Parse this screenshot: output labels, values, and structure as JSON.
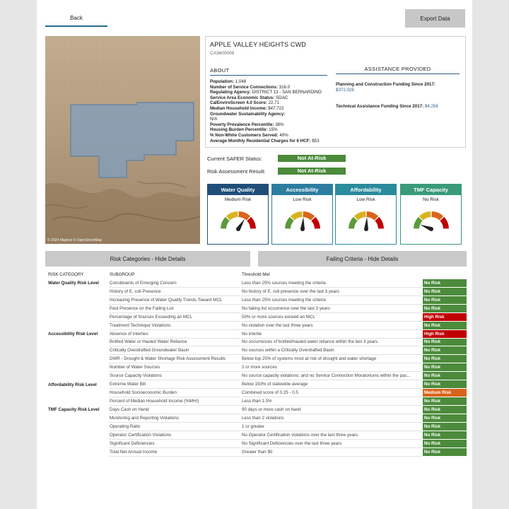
{
  "nav": {
    "back_label": "Back",
    "export_label": "Export Data"
  },
  "map": {
    "attribution": "© 2024 Mapbox © OpenStreetMap"
  },
  "system": {
    "name": "APPLE VALLEY HEIGHTS CWD",
    "id": "CA3600009"
  },
  "about": {
    "heading": "ABOUT",
    "rows": [
      {
        "label": "Population:",
        "value": "1,048"
      },
      {
        "label": "Number of Service Connections:",
        "value": "316.0"
      },
      {
        "label": "Regulating Agency:",
        "value": "DISTRICT 13 - SAN BERNARDINO"
      },
      {
        "label": "Service Area Economic Status:",
        "value": "SDAC"
      },
      {
        "label": "CalEnviroScreen 4.0 Score:",
        "value": "22.71"
      },
      {
        "label": "Median Household Income:",
        "value": "$47,722"
      },
      {
        "label": "Groundwater Sustainability Agency:",
        "value": ""
      },
      {
        "label": "",
        "value": "N/A"
      },
      {
        "label": "Poverty Prevalence Percentile:",
        "value": "38%"
      },
      {
        "label": "Housing Burden Percentile:",
        "value": "15%"
      },
      {
        "label": "% Non-White Customers Served:",
        "value": "40%"
      },
      {
        "label": "Average Monthly Residential Charges for 6 HCF:",
        "value": "$53"
      }
    ]
  },
  "assistance": {
    "heading": "ASSISTANCE PROVIDED",
    "planning_label": "Planning and Construction Funding Since 2017:",
    "planning_value": "$372,028",
    "technical_label": "Technical Assistance Funding Since 2017:",
    "technical_value": "$4,258"
  },
  "status": {
    "safer_label": "Current SAFER Status:",
    "safer_value": "Not At-Risk",
    "assessment_label": "Risk Assessment Result:",
    "assessment_value": "Not At-Risk"
  },
  "cards": [
    {
      "title": "Water Quality",
      "level": "Medium Risk",
      "color": "#1f4e79",
      "needle": 0.68
    },
    {
      "title": "Accessibility",
      "level": "Low Risk",
      "color": "#2c7da0",
      "needle": 0.52
    },
    {
      "title": "Affordability",
      "level": "Low Risk",
      "color": "#2a8b9c",
      "needle": 0.52
    },
    {
      "title": "TMF Capacity",
      "level": "No Risk",
      "color": "#3a9a7a",
      "needle": 0.12
    }
  ],
  "sections": {
    "risk_btn": "Risk Categories - Hide Details",
    "failing_btn": "Failing Criteria - Hide Details"
  },
  "table": {
    "headers": {
      "category": "RISK CATEGORY",
      "subgroup": "SUBGROUP",
      "threshold": "Threshold Met"
    },
    "colors": {
      "No Risk": "#4b8b3b",
      "High Risk": "#c00000",
      "Medium Risk": "#d9641c"
    },
    "rows": [
      {
        "category": "Water Quality Risk Level",
        "subgroup": "Constituents of Emerging Concern",
        "threshold": "Less than 25% sources meeting the criteria",
        "risk": "No Risk"
      },
      {
        "category": "",
        "subgroup": "History of E. coli Presence",
        "threshold": "No history of E. coli presence over the last 3 years",
        "risk": "No Risk"
      },
      {
        "category": "",
        "subgroup": "Increasing Presence of Water Quality Trends Toward MCL",
        "threshold": "Less than 25% sources meeting the criteria",
        "risk": "No Risk"
      },
      {
        "category": "",
        "subgroup": "Past Presence on the Failing List",
        "threshold": "No failing list occurrence over the last 3 years",
        "risk": "No Risk"
      },
      {
        "category": "",
        "subgroup": "Percentage of Sources Exceeding an MCL",
        "threshold": "50% or more sources exceed an MCL",
        "risk": "High Risk"
      },
      {
        "category": "",
        "subgroup": "Treatment Technique Violations",
        "threshold": "No violation over the last three years",
        "risk": "No Risk"
      },
      {
        "category": "Accessibility Risk Level",
        "subgroup": "Absence of Interties",
        "threshold": "No intertie",
        "risk": "High Risk"
      },
      {
        "category": "",
        "subgroup": "Bottled Water or Hauled Water Reliance",
        "threshold": "No occurrences of bottled/hauled water reliance within the last 3 years",
        "risk": "No Risk"
      },
      {
        "category": "",
        "subgroup": "Critically Overdrafted Groundwater Basin",
        "threshold": "No sources within a Critically Overdrafted Basin",
        "risk": "No Risk"
      },
      {
        "category": "",
        "subgroup": "DWR - Drought & Water Shortage Risk Assessment Results",
        "threshold": "Below top 25% of systems most at risk of drought and water shortage",
        "risk": "No Risk"
      },
      {
        "category": "",
        "subgroup": "Number of Water Sources",
        "threshold": "2 or more sources",
        "risk": "No Risk"
      },
      {
        "category": "",
        "subgroup": "Source Capacity Violations",
        "threshold": "No source capacity violations; and no Service Connection Moratoriums within the pas...",
        "risk": "No Risk"
      },
      {
        "category": "Affordability Risk Level",
        "subgroup": "Extreme Water Bill",
        "threshold": "Below 150% of statewide average",
        "risk": "No Risk"
      },
      {
        "category": "",
        "subgroup": "Household Socioeconomic Burden",
        "threshold": "Combined score of 0.25 - 0.5",
        "risk": "Medium Risk"
      },
      {
        "category": "",
        "subgroup": "Percent of Median Household Income (%MHI)",
        "threshold": "Less than 1.5%",
        "risk": "No Risk"
      },
      {
        "category": "TMF Capacity Risk Level",
        "subgroup": "Days Cash on Hand",
        "threshold": "90 days or more cash on hand",
        "risk": "No Risk"
      },
      {
        "category": "",
        "subgroup": "Monitoring and Reporting Violations",
        "threshold": "Less than 2 violations",
        "risk": "No Risk"
      },
      {
        "category": "",
        "subgroup": "Operating Ratio",
        "threshold": "1 or greater",
        "risk": "No Risk"
      },
      {
        "category": "",
        "subgroup": "Operator Certification Violations",
        "threshold": "No Operator Certification violations over the last three years",
        "risk": "No Risk"
      },
      {
        "category": "",
        "subgroup": "Significant Deficiencies",
        "threshold": "No Significant Deficiencies over the last three years",
        "risk": "No Risk"
      },
      {
        "category": "",
        "subgroup": "Total Net Annual Income",
        "threshold": "Greater than $0",
        "risk": "No Risk"
      }
    ]
  }
}
